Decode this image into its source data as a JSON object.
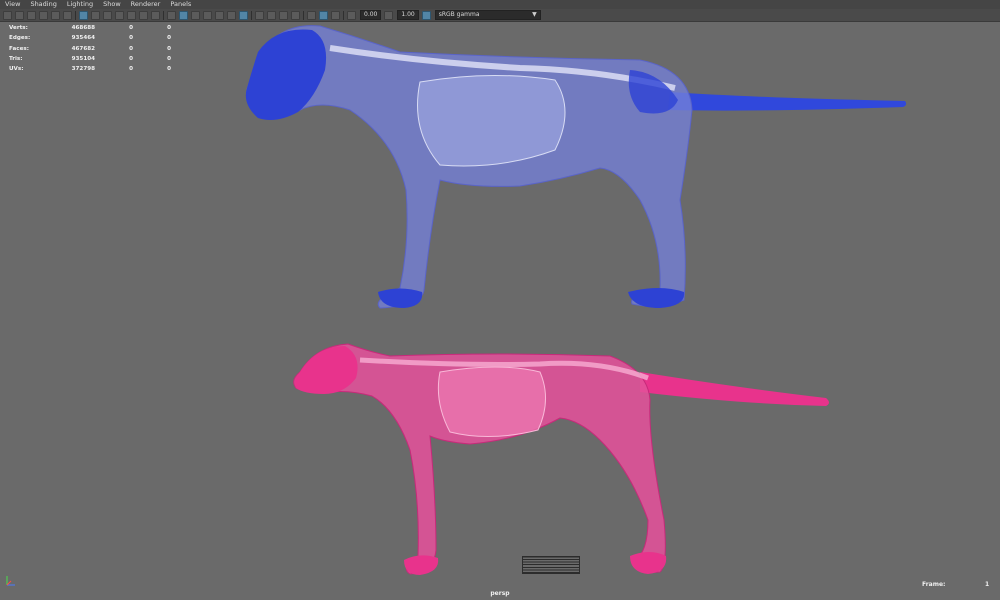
{
  "menu": [
    "View",
    "Shading",
    "Lighting",
    "Show",
    "Renderer",
    "Panels"
  ],
  "toolbar": {
    "exposure_value": "0.00",
    "gamma_value": "1.00",
    "color_space": "sRGB gamma"
  },
  "hud": {
    "rows": [
      {
        "label": "Verts:",
        "value": "468688",
        "selected": "0",
        "comp": "0"
      },
      {
        "label": "Edges:",
        "value": "935464",
        "selected": "0",
        "comp": "0"
      },
      {
        "label": "Faces:",
        "value": "467682",
        "selected": "0",
        "comp": "0"
      },
      {
        "label": "Tris:",
        "value": "935104",
        "selected": "0",
        "comp": "0"
      },
      {
        "label": "UVs:",
        "value": "372798",
        "selected": "0",
        "comp": "0"
      }
    ]
  },
  "viewport": {
    "camera": "persp",
    "frame_label": "Frame:",
    "frame_value": "1",
    "colors": {
      "background": "#6a6a6a",
      "lion": "#2f45d8",
      "cheetah": "#e3318a"
    }
  }
}
